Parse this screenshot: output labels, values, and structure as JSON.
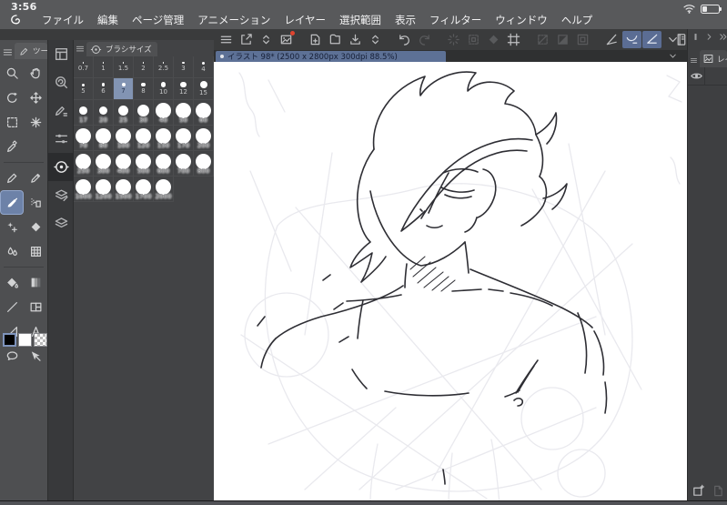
{
  "status_bar": {
    "time": "3:56",
    "icons": [
      "wifi-icon",
      "battery-icon"
    ]
  },
  "menu_bar": {
    "items": [
      "ファイル",
      "編集",
      "ページ管理",
      "アニメーション",
      "レイヤー",
      "選択範囲",
      "表示",
      "フィルター",
      "ウィンドウ",
      "ヘルプ"
    ]
  },
  "toolbar": {
    "groups": [
      {
        "items": [
          {
            "icon": "main-menu"
          },
          {
            "icon": "edit-shortcut"
          },
          {
            "icon": "collapse-arrows"
          },
          {
            "icon": "gallery",
            "badge": true
          }
        ]
      },
      {
        "items": [
          {
            "icon": "new-canvas"
          },
          {
            "icon": "open-file"
          },
          {
            "icon": "save-file"
          },
          {
            "icon": "collapse-arrows"
          }
        ]
      },
      {
        "items": [
          {
            "icon": "undo"
          },
          {
            "icon": "redo",
            "disabled": true
          }
        ]
      },
      {
        "items": [
          {
            "icon": "select-launcher",
            "disabled": true
          },
          {
            "icon": "select-layer",
            "disabled": true
          },
          {
            "icon": "fill-diamond",
            "disabled": true
          },
          {
            "icon": "crop-frame"
          }
        ]
      },
      {
        "items": [
          {
            "icon": "deselect",
            "disabled": true
          },
          {
            "icon": "invert-selection",
            "disabled": true
          },
          {
            "icon": "selection-border",
            "disabled": true
          }
        ]
      },
      {
        "items": [
          {
            "icon": "snap-ruler"
          },
          {
            "icon": "snap-special-ruler",
            "active": true
          },
          {
            "icon": "snap-grid",
            "active": true
          }
        ]
      },
      {
        "items": [
          {
            "icon": "reference-book"
          }
        ]
      },
      {
        "items": [
          {
            "icon": "help-circle"
          },
          {
            "icon": "pen-pressure"
          },
          {
            "icon": "pen-settings"
          }
        ]
      }
    ],
    "overflow_icon": "chevron-down"
  },
  "tool_palette": {
    "tab_label": "ツール",
    "tools": [
      {
        "name": "zoom"
      },
      {
        "name": "hand"
      },
      {
        "name": "rotate-canvas"
      },
      {
        "name": "move"
      },
      {
        "name": "selection"
      },
      {
        "name": "auto-select"
      },
      {
        "name": "eyedropper"
      },
      {
        "name": "blank"
      },
      {
        "sep": true
      },
      {
        "name": "pen"
      },
      {
        "name": "pencil"
      },
      {
        "name": "brush",
        "selected": true
      },
      {
        "name": "airbrush"
      },
      {
        "name": "decoration"
      },
      {
        "name": "eraser"
      },
      {
        "name": "blend"
      },
      {
        "name": "liquify"
      },
      {
        "sep": true
      },
      {
        "name": "fill"
      },
      {
        "name": "gradient"
      },
      {
        "name": "figure-line"
      },
      {
        "name": "frame-border"
      },
      {
        "name": "figure"
      },
      {
        "name": "text"
      },
      {
        "name": "balloon"
      },
      {
        "name": "operation"
      }
    ],
    "swatches": [
      {
        "name": "main-color",
        "value": "#000000",
        "selected": true
      },
      {
        "name": "sub-color",
        "value": "#ffffff"
      },
      {
        "name": "transparent-color",
        "checker": true
      }
    ]
  },
  "palette_strip": {
    "items": [
      {
        "icon": "tool-property"
      },
      {
        "icon": "sub-tool"
      },
      {
        "icon": "brush-settings"
      },
      {
        "icon": "tool-slider"
      },
      {
        "icon": "brush-size",
        "active": true
      },
      {
        "icon": "layer-property"
      },
      {
        "icon": "layers"
      }
    ]
  },
  "brush_size_palette": {
    "title": "ブラシサイズ",
    "sizes": [
      0.7,
      1,
      1.5,
      2,
      2.5,
      3,
      4,
      5,
      6,
      7,
      8,
      10,
      12,
      15,
      17,
      20,
      25,
      30,
      40,
      50,
      60,
      70,
      80,
      100,
      120,
      150,
      170,
      200,
      250,
      300,
      400,
      500,
      600,
      700,
      800,
      1000,
      1200,
      1500,
      1700,
      2000
    ],
    "selected_size": 7
  },
  "canvas": {
    "tab_title": "イラスト 98* (2500 x 2800px 300dpi 88.5%)"
  },
  "layer_panel": {
    "collapse_icons": [
      "panel-bar",
      "panel-expand",
      "panel-expand-all"
    ],
    "tab_label": "レイヤー",
    "layer_row_icons": [
      "eye"
    ],
    "bottom_icons": [
      {
        "icon": "new-layer"
      },
      {
        "icon": "new-page",
        "disabled": true
      }
    ]
  },
  "colors": {
    "topbar_gray": "#58595b",
    "toolbar_gray": "#3a3b3c",
    "panel_gray": "#4e4f51",
    "selection_blue": "#8294b3",
    "accent_blue": "#5b6d94",
    "tab_blue": "#5d7196",
    "canvas_white": "#ffffff"
  }
}
